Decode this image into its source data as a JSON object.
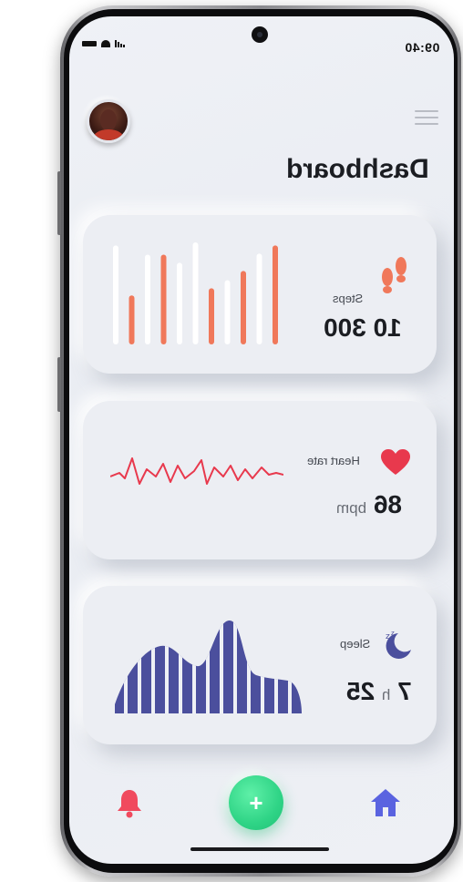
{
  "status_bar": {
    "time": "09:40"
  },
  "header": {
    "title": "Dashboard",
    "menu_icon": "hamburger-menu-icon",
    "avatar_icon": "user-avatar"
  },
  "cards": {
    "steps": {
      "label": "Steps",
      "value": "10 300",
      "icon": "footprints-icon",
      "accent_color": "#f0785a",
      "bars": [
        {
          "level": 0.97,
          "kind": "white"
        },
        {
          "level": 0.48,
          "kind": "orange"
        },
        {
          "level": 0.88,
          "kind": "white"
        },
        {
          "level": 0.88,
          "kind": "orange"
        },
        {
          "level": 0.8,
          "kind": "white"
        },
        {
          "level": 1.0,
          "kind": "white"
        },
        {
          "level": 0.55,
          "kind": "orange"
        },
        {
          "level": 0.63,
          "kind": "white"
        },
        {
          "level": 0.72,
          "kind": "orange"
        },
        {
          "level": 0.89,
          "kind": "white"
        },
        {
          "level": 0.97,
          "kind": "orange"
        }
      ]
    },
    "heart_rate": {
      "label": "Heart rate",
      "value": "86",
      "unit": "bpm",
      "icon": "heart-icon",
      "accent_color": "#e8394d"
    },
    "sleep": {
      "label": "Sleep",
      "value_hours": "7",
      "value_hours_unit": "h",
      "value_minutes": "25",
      "icon": "moon-zzz-icon",
      "accent_color": "#5a5fb4"
    }
  },
  "bottom_nav": {
    "home_icon": "home-icon",
    "add_label": "+",
    "notifications_icon": "bell-icon",
    "home_color": "#5a63e0",
    "add_color": "#2fd486",
    "bell_color": "#f04a5e"
  }
}
